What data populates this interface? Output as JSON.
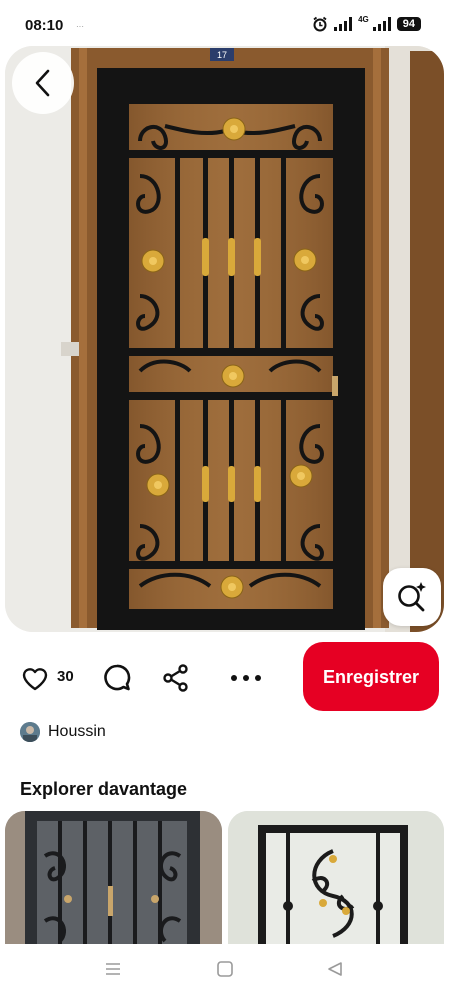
{
  "status_bar": {
    "time": "08:10",
    "small_indicator": "···",
    "network": "4G",
    "battery": "94"
  },
  "pin": {
    "door_number": "17",
    "like_count": "30",
    "save_label": "Enregistrer",
    "author_name": "Houssin"
  },
  "explore": {
    "title": "Explorer davantage"
  },
  "icons": {
    "back": "chevron-left-icon",
    "lens": "visual-search-icon",
    "like": "heart-icon",
    "comment": "comment-bubble-icon",
    "share": "share-icon",
    "more": "more-dots-icon",
    "nav_menu": "menu-icon",
    "nav_home": "home-square-icon",
    "nav_back": "back-triangle-icon"
  },
  "colors": {
    "accent": "#e60023",
    "door_frame": "#8a5a2e",
    "iron": "#141414",
    "ornament": "#d9a93a"
  }
}
